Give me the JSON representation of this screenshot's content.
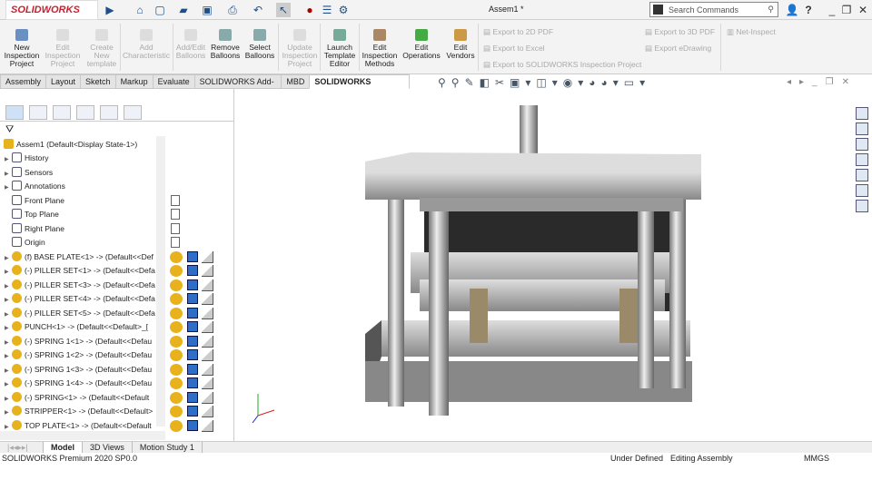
{
  "app": {
    "logo": "SOLIDWORKS",
    "doc_title": "Assem1 *",
    "search_placeholder": "Search Commands"
  },
  "ribbon": {
    "buttons": [
      {
        "label": "New Inspection Project",
        "enabled": true
      },
      {
        "label": "Edit Inspection Project",
        "enabled": false
      },
      {
        "label": "Create New template",
        "enabled": false
      },
      {
        "label": "Add Characteristic",
        "enabled": false
      },
      {
        "label": "Add/Edit Balloons",
        "enabled": false
      },
      {
        "label": "Remove Balloons",
        "enabled": true
      },
      {
        "label": "Select Balloons",
        "enabled": true
      },
      {
        "label": "Update Inspection Project",
        "enabled": false
      },
      {
        "label": "Launch Template Editor",
        "enabled": true
      },
      {
        "label": "Edit Inspection Methods",
        "enabled": true
      },
      {
        "label": "Edit Operations",
        "enabled": true
      },
      {
        "label": "Edit Vendors",
        "enabled": true
      }
    ],
    "exports": [
      "Export to 2D PDF",
      "Export to Excel",
      "Export to SOLIDWORKS Inspection Project",
      "Export to 3D PDF",
      "Export eDrawing",
      "Net-Inspect"
    ]
  },
  "tabs": [
    "Assembly",
    "Layout",
    "Sketch",
    "Markup",
    "Evaluate",
    "SOLIDWORKS Add-Ins",
    "MBD",
    "SOLIDWORKS Inspection"
  ],
  "tree": {
    "root": "Assem1  (Default<Display State-1>)",
    "items": [
      "History",
      "Sensors",
      "Annotations",
      "Front Plane",
      "Top Plane",
      "Right Plane",
      "Origin",
      "(f) BASE PLATE<1> -> (Default<<Def",
      "(-) PILLER SET<1> -> (Default<<Defa",
      "(-) PILLER SET<3> -> (Default<<Defa",
      "(-) PILLER SET<4> -> (Default<<Defa",
      "(-) PILLER SET<5> -> (Default<<Defa",
      "PUNCH<1> -> (Default<<Default>_[",
      "(-) SPRING 1<1> -> (Default<<Defau",
      "(-) SPRING 1<2> -> (Default<<Defau",
      "(-) SPRING 1<3> -> (Default<<Defau",
      "(-) SPRING 1<4> -> (Default<<Defau",
      "(-) SPRING<1> -> (Default<<Default",
      "STRIPPER<1> -> (Default<<Default>",
      "TOP PLATE<1> -> (Default<<Default"
    ]
  },
  "bottom_tabs": [
    "Model",
    "3D Views",
    "Motion Study 1"
  ],
  "status": {
    "product": "SOLIDWORKS Premium 2020 SP0.0",
    "state": "Under Defined",
    "mode": "Editing Assembly",
    "units": "MMGS"
  }
}
